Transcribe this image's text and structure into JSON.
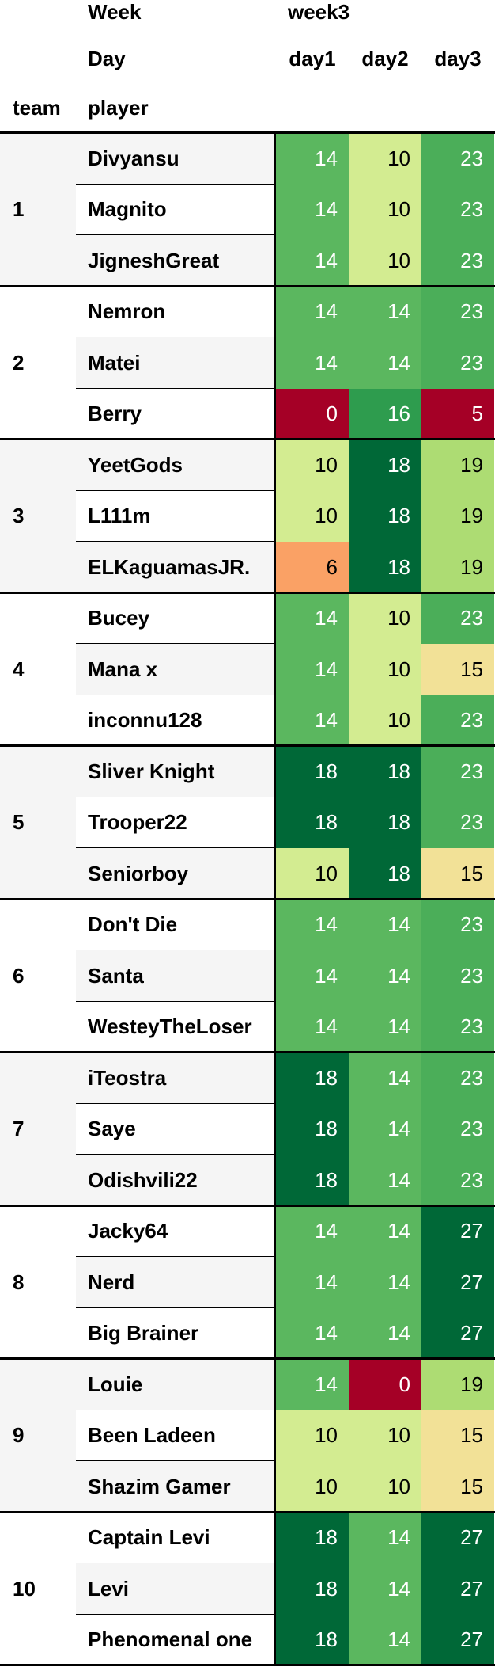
{
  "header": {
    "week_label": "Week",
    "week_value": "week3",
    "day_label": "Day",
    "team_label": "team",
    "player_label": "player"
  },
  "chart_data": {
    "type": "table",
    "columns": [
      "day1",
      "day2",
      "day3"
    ],
    "color_scale": {
      "low": "#a50026",
      "mid": "#ffffbf",
      "high": "#006837"
    },
    "groups": [
      {
        "team": "1",
        "rows": [
          {
            "player": "Divyansu",
            "values": [
              14,
              10,
              23
            ]
          },
          {
            "player": "Magnito",
            "values": [
              14,
              10,
              23
            ]
          },
          {
            "player": "JigneshGreat",
            "values": [
              14,
              10,
              23
            ]
          }
        ]
      },
      {
        "team": "2",
        "rows": [
          {
            "player": "Nemron",
            "values": [
              14,
              14,
              23
            ]
          },
          {
            "player": "Matei",
            "values": [
              14,
              14,
              23
            ]
          },
          {
            "player": "Berry",
            "values": [
              0,
              16,
              5
            ]
          }
        ]
      },
      {
        "team": "3",
        "rows": [
          {
            "player": "YeetGods",
            "values": [
              10,
              18,
              19
            ]
          },
          {
            "player": "L111m",
            "values": [
              10,
              18,
              19
            ]
          },
          {
            "player": "ELKaguamasJR.",
            "values": [
              6,
              18,
              19
            ]
          }
        ]
      },
      {
        "team": "4",
        "rows": [
          {
            "player": "Bucey",
            "values": [
              14,
              10,
              23
            ]
          },
          {
            "player": "Mana x",
            "values": [
              14,
              10,
              15
            ]
          },
          {
            "player": "inconnu128",
            "values": [
              14,
              10,
              23
            ]
          }
        ]
      },
      {
        "team": "5",
        "rows": [
          {
            "player": "Sliver Knight",
            "values": [
              18,
              18,
              23
            ]
          },
          {
            "player": "Trooper22",
            "values": [
              18,
              18,
              23
            ]
          },
          {
            "player": "Seniorboy",
            "values": [
              10,
              18,
              15
            ]
          }
        ]
      },
      {
        "team": "6",
        "rows": [
          {
            "player": "Don't Die",
            "values": [
              14,
              14,
              23
            ]
          },
          {
            "player": "Santa",
            "values": [
              14,
              14,
              23
            ]
          },
          {
            "player": "WesteyTheLoser",
            "values": [
              14,
              14,
              23
            ]
          }
        ]
      },
      {
        "team": "7",
        "rows": [
          {
            "player": "iTeostra",
            "values": [
              18,
              14,
              23
            ]
          },
          {
            "player": "Saye",
            "values": [
              18,
              14,
              23
            ]
          },
          {
            "player": "Odishvili22",
            "values": [
              18,
              14,
              23
            ]
          }
        ]
      },
      {
        "team": "8",
        "rows": [
          {
            "player": "Jacky64",
            "values": [
              14,
              14,
              27
            ]
          },
          {
            "player": "Nerd",
            "values": [
              14,
              14,
              27
            ]
          },
          {
            "player": "Big Brainer",
            "values": [
              14,
              14,
              27
            ]
          }
        ]
      },
      {
        "team": "9",
        "rows": [
          {
            "player": "Louie",
            "values": [
              14,
              0,
              19
            ]
          },
          {
            "player": "Been Ladeen",
            "values": [
              10,
              10,
              15
            ]
          },
          {
            "player": "Shazim Gamer",
            "values": [
              10,
              10,
              15
            ]
          }
        ]
      },
      {
        "team": "10",
        "rows": [
          {
            "player": "Captain Levi",
            "values": [
              18,
              14,
              27
            ]
          },
          {
            "player": "Levi",
            "values": [
              18,
              14,
              27
            ]
          },
          {
            "player": "Phenomenal one",
            "values": [
              18,
              14,
              27
            ]
          }
        ]
      }
    ]
  }
}
